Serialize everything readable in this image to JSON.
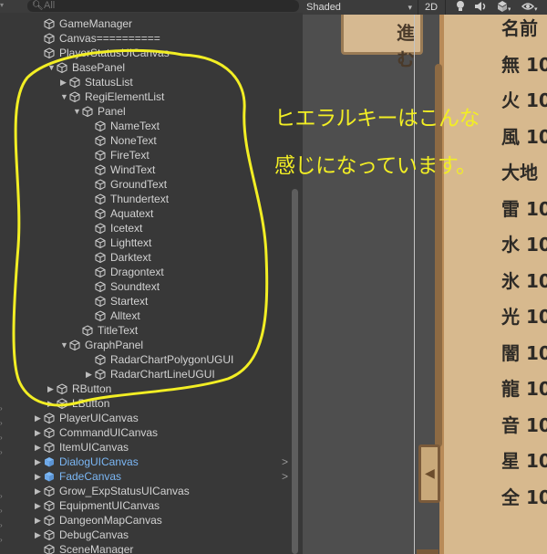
{
  "search": {
    "placeholder": "All"
  },
  "hierarchy": {
    "items": [
      {
        "label": "GameManager",
        "depth": 0,
        "arrow": "",
        "prefab": false
      },
      {
        "label": "Canvas==========",
        "depth": 0,
        "arrow": "",
        "prefab": false
      },
      {
        "label": "PlayerStatusUICanvas",
        "depth": 0,
        "arrow": "",
        "prefab": false
      },
      {
        "label": "BasePanel",
        "depth": 1,
        "arrow": "down",
        "prefab": false
      },
      {
        "label": "StatusList",
        "depth": 2,
        "arrow": "right",
        "prefab": false
      },
      {
        "label": "RegiElementList",
        "depth": 2,
        "arrow": "down",
        "prefab": false
      },
      {
        "label": "Panel",
        "depth": 3,
        "arrow": "down",
        "prefab": false
      },
      {
        "label": "NameText",
        "depth": 4,
        "arrow": "",
        "prefab": false
      },
      {
        "label": "NoneText",
        "depth": 4,
        "arrow": "",
        "prefab": false
      },
      {
        "label": "FireText",
        "depth": 4,
        "arrow": "",
        "prefab": false
      },
      {
        "label": "WindText",
        "depth": 4,
        "arrow": "",
        "prefab": false
      },
      {
        "label": "GroundText",
        "depth": 4,
        "arrow": "",
        "prefab": false
      },
      {
        "label": "Thundertext",
        "depth": 4,
        "arrow": "",
        "prefab": false
      },
      {
        "label": "Aquatext",
        "depth": 4,
        "arrow": "",
        "prefab": false
      },
      {
        "label": "Icetext",
        "depth": 4,
        "arrow": "",
        "prefab": false
      },
      {
        "label": "Lighttext",
        "depth": 4,
        "arrow": "",
        "prefab": false
      },
      {
        "label": "Darktext",
        "depth": 4,
        "arrow": "",
        "prefab": false
      },
      {
        "label": "Dragontext",
        "depth": 4,
        "arrow": "",
        "prefab": false
      },
      {
        "label": "Soundtext",
        "depth": 4,
        "arrow": "",
        "prefab": false
      },
      {
        "label": "Startext",
        "depth": 4,
        "arrow": "",
        "prefab": false
      },
      {
        "label": "Alltext",
        "depth": 4,
        "arrow": "",
        "prefab": false
      },
      {
        "label": "TitleText",
        "depth": 3,
        "arrow": "",
        "prefab": false
      },
      {
        "label": "GraphPanel",
        "depth": 2,
        "arrow": "down",
        "prefab": false
      },
      {
        "label": "RadarChartPolygonUGUI",
        "depth": 4,
        "arrow": "",
        "prefab": false
      },
      {
        "label": "RadarChartLineUGUI",
        "depth": 4,
        "arrow": "right",
        "prefab": false
      },
      {
        "label": "RButton",
        "depth": 1,
        "arrow": "right",
        "prefab": false
      },
      {
        "label": "LButton",
        "depth": 1,
        "arrow": "right",
        "prefab": false
      },
      {
        "label": "PlayerUICanvas",
        "depth": 0,
        "arrow": "right",
        "prefab": false
      },
      {
        "label": "CommandUICanvas",
        "depth": 0,
        "arrow": "right",
        "prefab": false
      },
      {
        "label": "ItemUICanvas",
        "depth": 0,
        "arrow": "right",
        "prefab": false
      },
      {
        "label": "DialogUICanvas",
        "depth": 0,
        "arrow": "right",
        "prefab": true
      },
      {
        "label": "FadeCanvas",
        "depth": 0,
        "arrow": "right",
        "prefab": true
      },
      {
        "label": "Grow_ExpStatusUICanvas",
        "depth": 0,
        "arrow": "right",
        "prefab": false
      },
      {
        "label": "EquipmentUICanvas",
        "depth": 0,
        "arrow": "right",
        "prefab": false
      },
      {
        "label": "DangeonMapCanvas",
        "depth": 0,
        "arrow": "right",
        "prefab": false
      },
      {
        "label": "DebugCanvas",
        "depth": 0,
        "arrow": "right",
        "prefab": false
      },
      {
        "label": "SceneManager",
        "depth": 0,
        "arrow": "",
        "prefab": false
      }
    ],
    "more_glyph": ">",
    "prefab_color": "#7bb7f5",
    "text_color": "#d2d2d2"
  },
  "scene_toolbar": {
    "shading_mode": "Shaded",
    "mode_2d": "2D",
    "icons": [
      "light-bulb-icon",
      "audio-icon",
      "effects-icon",
      "visibility-icon"
    ]
  },
  "scene": {
    "title_fragment": "進む",
    "stats": [
      "名前",
      "無 10",
      "火 10",
      "風 10",
      "大地",
      "雷 10",
      "水 10",
      "氷 10",
      "光 10",
      "闇 10",
      "龍 10",
      "音 10",
      "星 10",
      "全 10"
    ]
  },
  "annotation": {
    "line1": "ヒエラルキーはこんな",
    "line2": "感じになっています。",
    "color": "#f2ee24"
  }
}
